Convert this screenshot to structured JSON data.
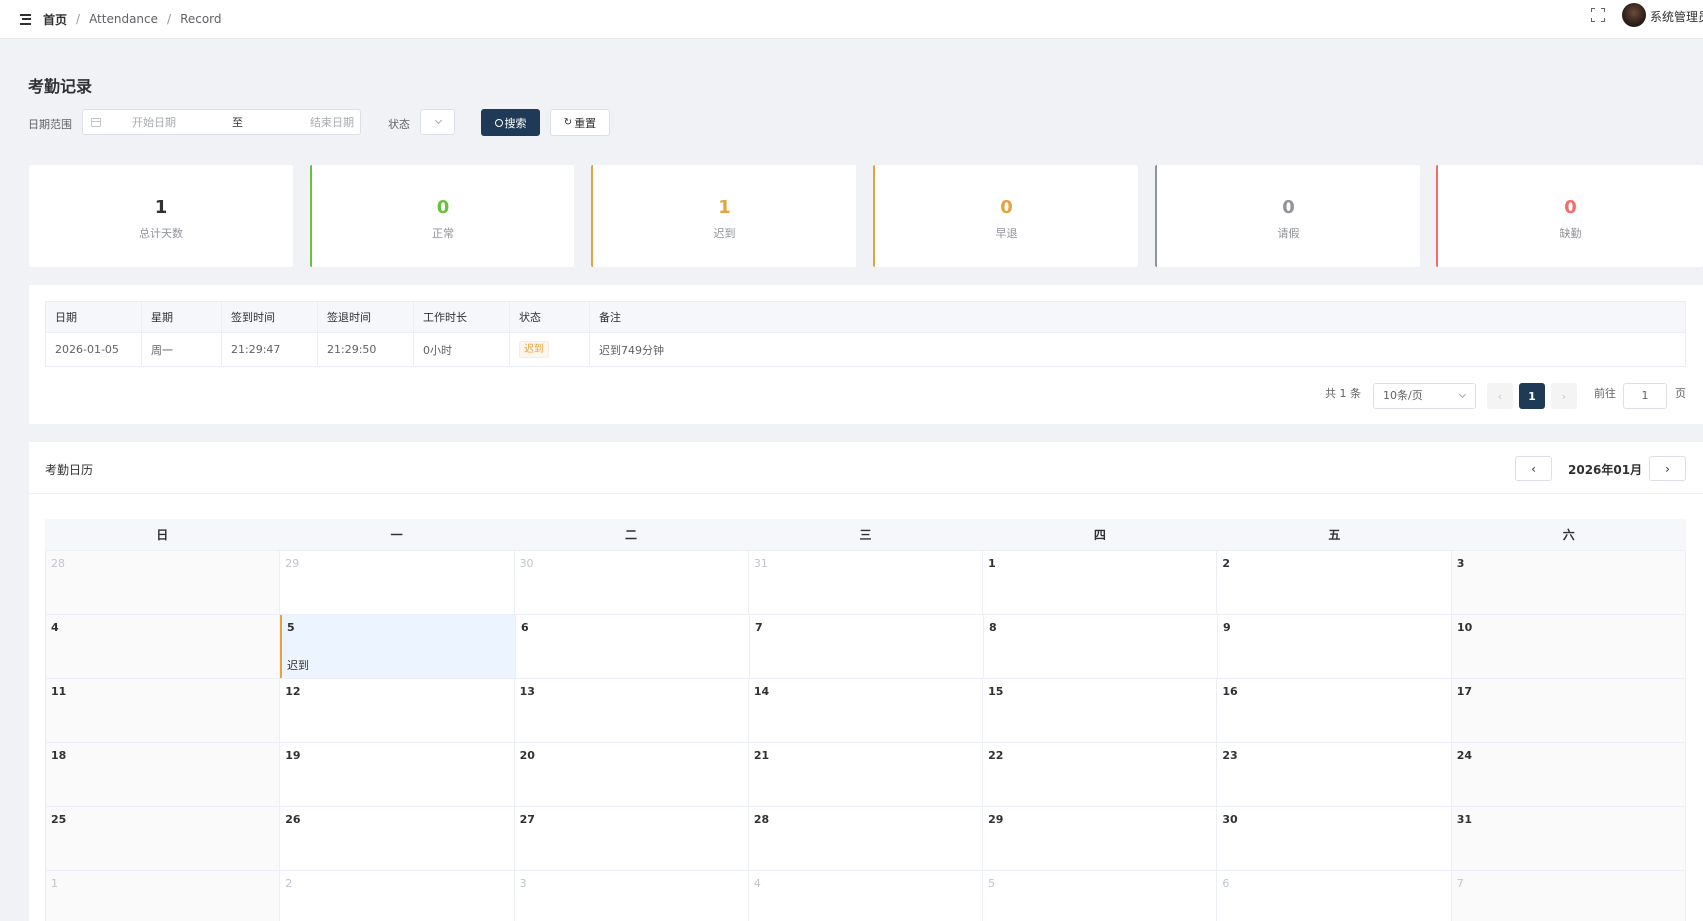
{
  "nav": {
    "home": "首页",
    "crumbs": [
      "Attendance",
      "Record"
    ],
    "separator": "/",
    "user_name": "系统管理员",
    "icons": {
      "menu": "hamburger-icon",
      "fullscreen": "fullscreen-icon",
      "avatar": "avatar"
    }
  },
  "page": {
    "title": "考勤记录"
  },
  "filters": {
    "date_label": "日期范围",
    "start_placeholder": "开始日期",
    "range_separator": "至",
    "end_placeholder": "结束日期",
    "status_label": "状态",
    "status_value": "",
    "search_label": "搜索",
    "reset_label": "重置"
  },
  "stats": [
    {
      "value": "1",
      "label": "总计天数",
      "color": "#303133",
      "accent": ""
    },
    {
      "value": "0",
      "label": "正常",
      "color": "#67c23a",
      "accent": "#67c23a"
    },
    {
      "value": "1",
      "label": "迟到",
      "color": "#e6a23c",
      "accent": "#e6a23c"
    },
    {
      "value": "0",
      "label": "早退",
      "color": "#e6a23c",
      "accent": "#e6a23c"
    },
    {
      "value": "0",
      "label": "请假",
      "color": "#909399",
      "accent": "#909399"
    },
    {
      "value": "0",
      "label": "缺勤",
      "color": "#f56c6c",
      "accent": "#f56c6c"
    }
  ],
  "table": {
    "headers": [
      "日期",
      "星期",
      "签到时间",
      "签退时间",
      "工作时长",
      "状态",
      "备注"
    ],
    "rows": [
      {
        "date": "2026-01-05",
        "weekday": "周一",
        "check_in": "21:29:47",
        "check_out": "21:29:50",
        "duration": "0小时",
        "status": "迟到",
        "remark": "迟到749分钟"
      }
    ]
  },
  "pagination": {
    "total_text": "共 1 条",
    "page_size": "10条/页",
    "current_page": "1",
    "goto_label": "前往",
    "goto_value": "1",
    "page_suffix": "页"
  },
  "calendar": {
    "title": "考勤日历",
    "month": "2026年01月",
    "prev_label": "‹",
    "next_label": "›",
    "weekdays": [
      "日",
      "一",
      "二",
      "三",
      "四",
      "五",
      "六"
    ],
    "weeks": [
      [
        {
          "d": "28",
          "other": true
        },
        {
          "d": "29",
          "other": true
        },
        {
          "d": "30",
          "other": true
        },
        {
          "d": "31",
          "other": true
        },
        {
          "d": "1"
        },
        {
          "d": "2"
        },
        {
          "d": "3"
        }
      ],
      [
        {
          "d": "4"
        },
        {
          "d": "5",
          "note": "迟到",
          "late": true
        },
        {
          "d": "6"
        },
        {
          "d": "7"
        },
        {
          "d": "8"
        },
        {
          "d": "9"
        },
        {
          "d": "10"
        }
      ],
      [
        {
          "d": "11"
        },
        {
          "d": "12"
        },
        {
          "d": "13"
        },
        {
          "d": "14"
        },
        {
          "d": "15"
        },
        {
          "d": "16"
        },
        {
          "d": "17"
        }
      ],
      [
        {
          "d": "18"
        },
        {
          "d": "19"
        },
        {
          "d": "20"
        },
        {
          "d": "21"
        },
        {
          "d": "22"
        },
        {
          "d": "23"
        },
        {
          "d": "24"
        }
      ],
      [
        {
          "d": "25"
        },
        {
          "d": "26"
        },
        {
          "d": "27"
        },
        {
          "d": "28"
        },
        {
          "d": "29"
        },
        {
          "d": "30"
        },
        {
          "d": "31"
        }
      ],
      [
        {
          "d": "1",
          "other": true
        },
        {
          "d": "2",
          "other": true
        },
        {
          "d": "3",
          "other": true
        },
        {
          "d": "4",
          "other": true
        },
        {
          "d": "5",
          "other": true
        },
        {
          "d": "6",
          "other": true
        },
        {
          "d": "7",
          "other": true
        }
      ]
    ]
  }
}
